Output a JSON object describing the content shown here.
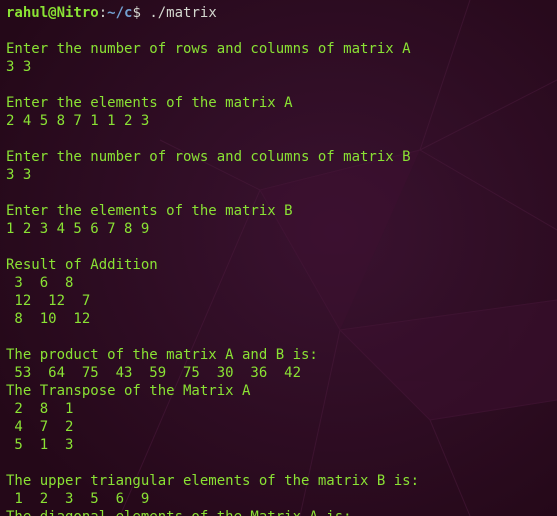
{
  "prompt": {
    "user_host": "rahul@Nitro",
    "separator": ":",
    "path": "~/c",
    "symbol": "$",
    "command": " ./matrix"
  },
  "output_lines": [
    "",
    "Enter the number of rows and columns of matrix A",
    "3 3",
    "",
    "Enter the elements of the matrix A",
    "2 4 5 8 7 1 1 2 3",
    "",
    "Enter the number of rows and columns of matrix B",
    "3 3",
    "",
    "Enter the elements of the matrix B",
    "1 2 3 4 5 6 7 8 9",
    "",
    "Result of Addition",
    " 3  6  8",
    " 12  12  7",
    " 8  10  12",
    "",
    "The product of the matrix A and B is:",
    " 53  64  75  43  59  75  30  36  42",
    "The Transpose of the Matrix A",
    " 2  8  1",
    " 4  7  2",
    " 5  1  3",
    "",
    "The upper triangular elements of the matrix B is:",
    " 1  2  3  5  6  9",
    "The diagonal elements of the Matrix A is:"
  ],
  "colors": {
    "background": "#2b0b20",
    "output_text": "#8ae234",
    "prompt_user": "#8ae234",
    "prompt_path": "#729fcf",
    "prompt_plain": "#d3d7cf"
  }
}
